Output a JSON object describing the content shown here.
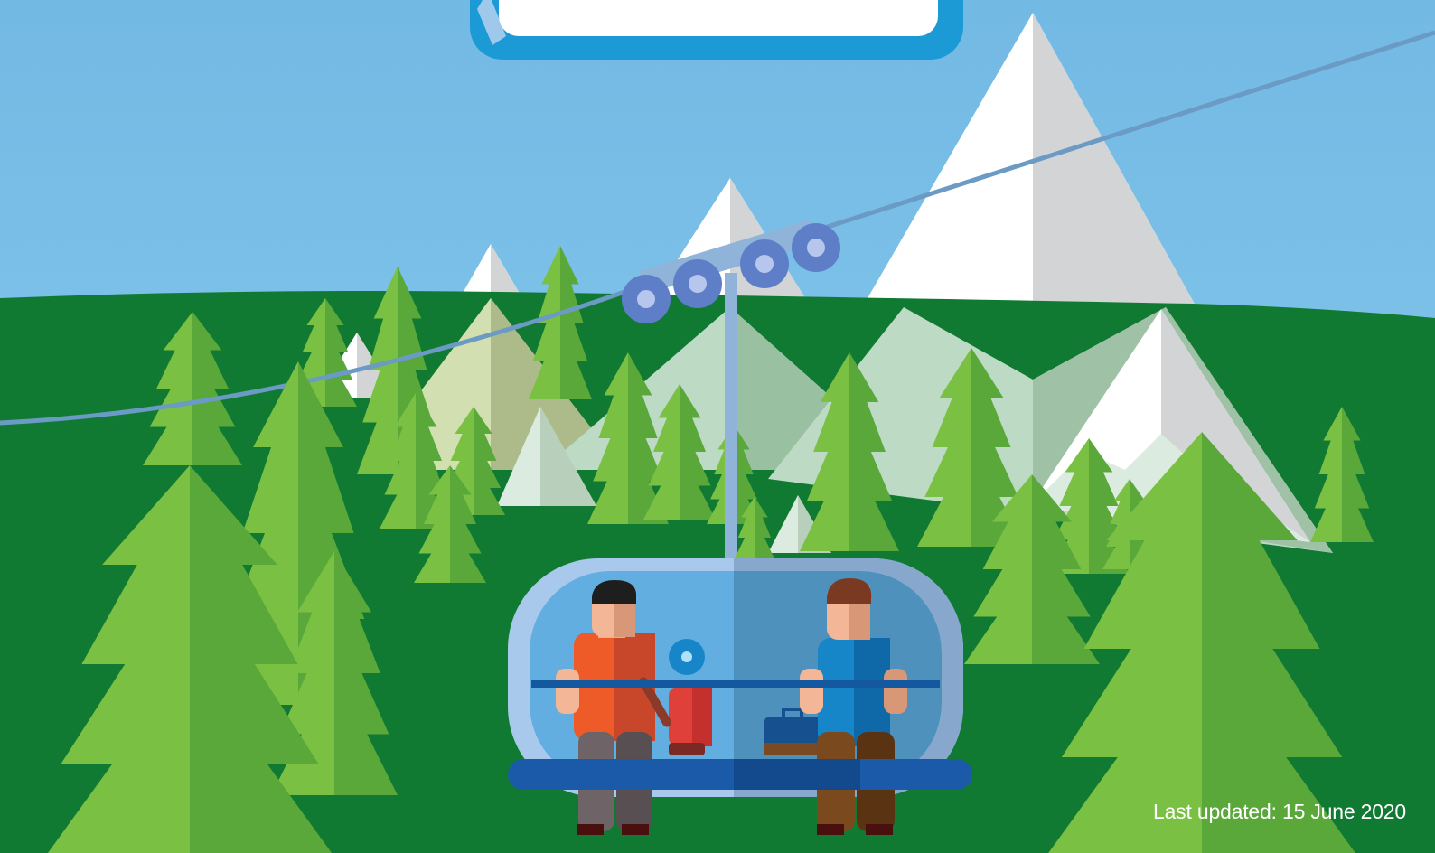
{
  "footer": {
    "last_updated": "Last updated: 15 June 2020"
  },
  "illustration": {
    "subject": "gondola-lift",
    "passengers": 2
  },
  "colors": {
    "sky": "#7ec3e8",
    "hill": "#117a32",
    "tree_light": "#7ac143",
    "tree_dark": "#5aa83a",
    "mountain_light": "#ffffff",
    "mountain_shade": "#d2d4d6",
    "cable": "#6b9ac4",
    "cabin_frame": "#a8c8ec",
    "cabin_glass": "#62aee0",
    "seat": "#1a5aa8",
    "banner_border": "#1c9ad6",
    "passenger_left_shirt": "#ef5b28",
    "passenger_right_shirt": "#1786c8"
  }
}
